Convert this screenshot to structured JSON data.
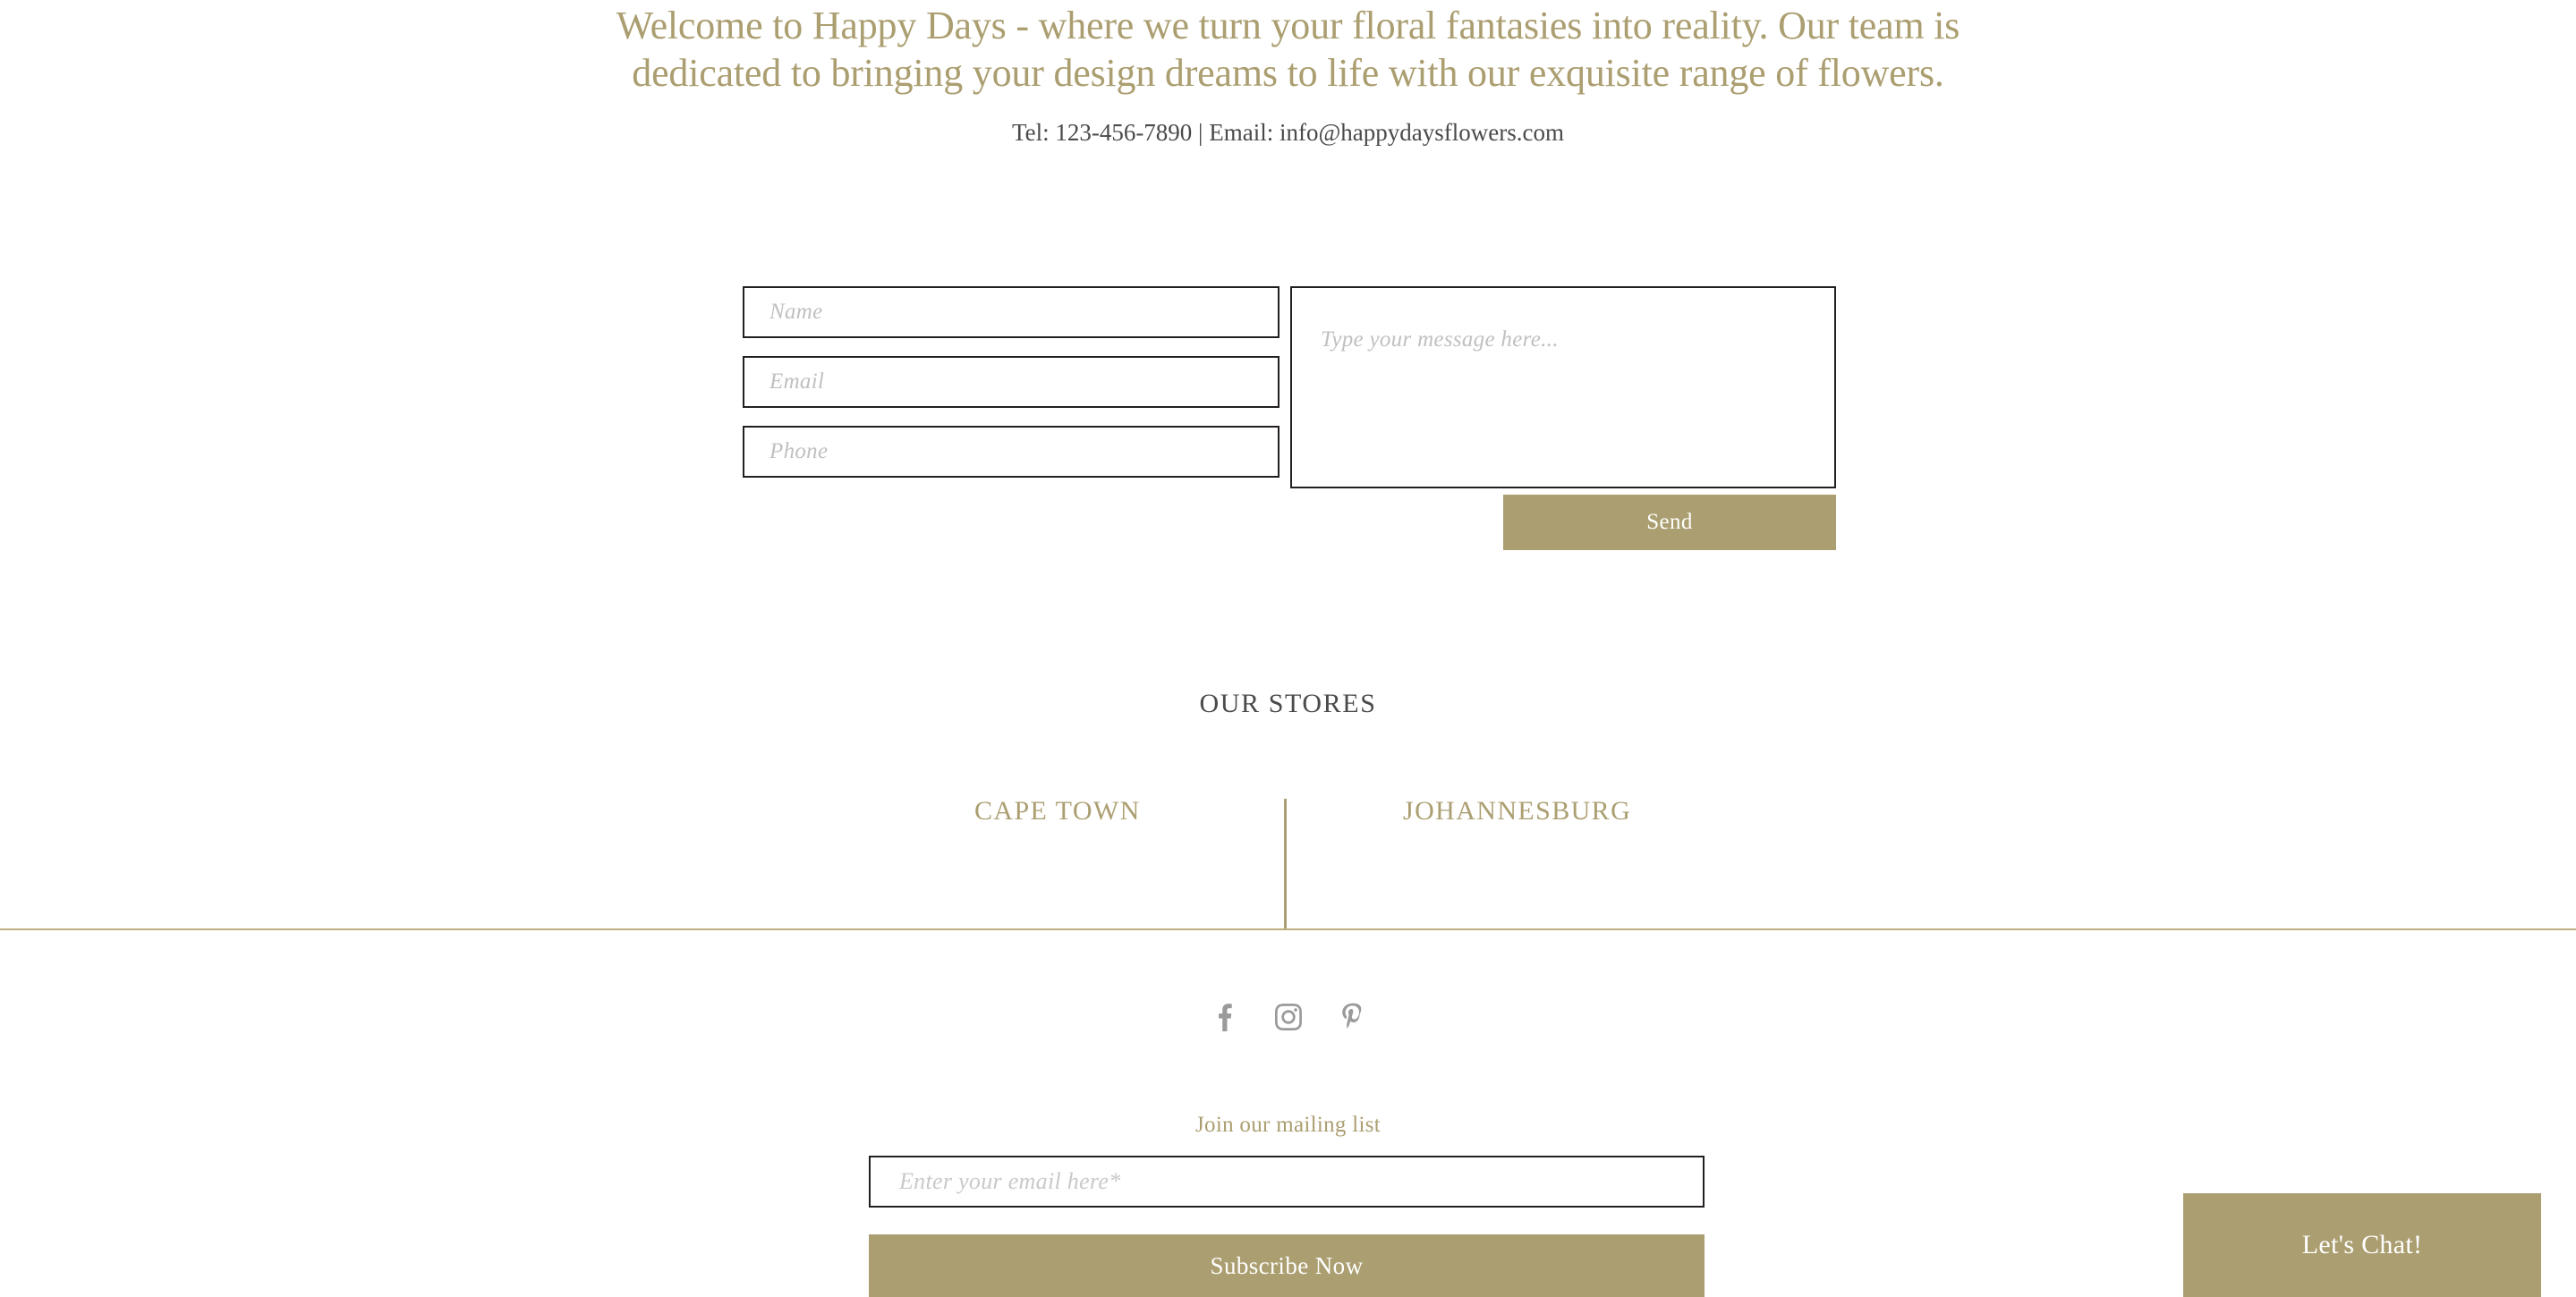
{
  "intro": {
    "heading": "Welcome to Happy Days - where we turn your floral fantasies into reality. Our team is dedicated to bringing your design dreams to life with our exquisite range of flowers.",
    "contact_line": "Tel: 123-456-7890 | Email: info@happydaysflowers.com"
  },
  "contact_form": {
    "name_placeholder": "Name",
    "name_value": "",
    "email_placeholder": "Email",
    "email_value": "",
    "phone_placeholder": "Phone",
    "phone_value": "",
    "message_placeholder": "Type your message here...",
    "message_value": "",
    "send_label": "Send"
  },
  "stores": {
    "title": "OUR STORES",
    "locations": [
      {
        "name": "CAPE TOWN"
      },
      {
        "name": "JOHANNESBURG"
      }
    ]
  },
  "social": {
    "items": [
      {
        "icon": "facebook-icon",
        "label": "Facebook"
      },
      {
        "icon": "instagram-icon",
        "label": "Instagram"
      },
      {
        "icon": "pinterest-icon",
        "label": "Pinterest"
      }
    ]
  },
  "mailing_list": {
    "title": "Join our mailing list",
    "email_placeholder": "Enter your email here*",
    "email_value": "",
    "subscribe_label": "Subscribe Now"
  },
  "chat": {
    "label": "Let's Chat!"
  },
  "colors": {
    "accent_gold": "#ab9e70",
    "rule_gold": "#bdaf80",
    "text_dark": "#4a4a4a",
    "border_dark": "#231f20",
    "placeholder_gray": "#c0c0c0",
    "social_gray": "#9a9a9a"
  }
}
